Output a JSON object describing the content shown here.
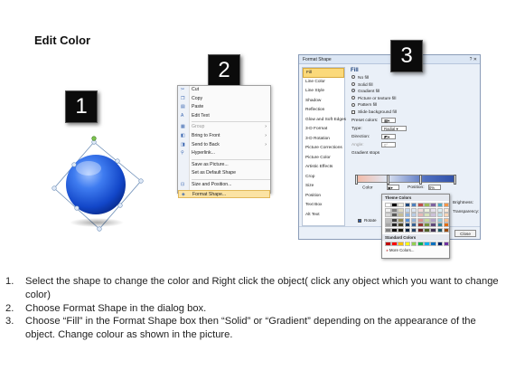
{
  "title": "Edit Color",
  "steps": [
    "1",
    "2",
    "3"
  ],
  "context_menu": {
    "items": [
      {
        "label": "Cut",
        "icon": "scissors-icon",
        "glyph": "✂",
        "disabled": false,
        "submenu": false
      },
      {
        "label": "Copy",
        "icon": "copy-icon",
        "glyph": "❐",
        "disabled": false,
        "submenu": false
      },
      {
        "label": "Paste",
        "icon": "paste-icon",
        "glyph": "▤",
        "disabled": false,
        "submenu": false
      },
      {
        "label": "Edit Text",
        "icon": "edit-text-icon",
        "glyph": "A",
        "disabled": false,
        "submenu": false
      },
      {
        "label": "Group",
        "icon": "group-icon",
        "glyph": "▦",
        "disabled": true,
        "submenu": true
      },
      {
        "label": "Bring to Front",
        "icon": "bring-front-icon",
        "glyph": "◧",
        "disabled": false,
        "submenu": true
      },
      {
        "label": "Send to Back",
        "icon": "send-back-icon",
        "glyph": "◨",
        "disabled": false,
        "submenu": true
      },
      {
        "label": "Hyperlink...",
        "icon": "hyperlink-icon",
        "glyph": "⚲",
        "disabled": false,
        "submenu": false
      },
      {
        "label": "Save as Picture...",
        "icon": "",
        "glyph": "",
        "disabled": false,
        "submenu": false
      },
      {
        "label": "Set as Default Shape",
        "icon": "",
        "glyph": "",
        "disabled": false,
        "submenu": false
      },
      {
        "label": "Size and Position...",
        "icon": "size-position-icon",
        "glyph": "⊡",
        "disabled": false,
        "submenu": false
      },
      {
        "label": "Format Shape...",
        "icon": "format-shape-icon",
        "glyph": "◈",
        "disabled": false,
        "submenu": false,
        "highlighted": true
      }
    ]
  },
  "dialog": {
    "title": "Format Shape",
    "window_controls": "? ✕",
    "nav": [
      "Fill",
      "Line Color",
      "Line Style",
      "Shadow",
      "Reflection",
      "Glow and Soft Edges",
      "3-D Format",
      "3-D Rotation",
      "Picture Corrections",
      "Picture Color",
      "Artistic Effects",
      "Crop",
      "Size",
      "Position",
      "Text Box",
      "Alt Text"
    ],
    "selected_nav": "Fill",
    "fill_heading": "Fill",
    "fill_options": [
      {
        "label": "No fill",
        "selected": false
      },
      {
        "label": "Solid fill",
        "selected": false
      },
      {
        "label": "Gradient fill",
        "selected": true
      },
      {
        "label": "Picture or texture fill",
        "selected": false
      },
      {
        "label": "Pattern fill",
        "selected": false
      }
    ],
    "slide_background_fill": "Slide background fill",
    "preset_colors_label": "Preset colors:",
    "type_label": "Type:",
    "type_value": "Radial",
    "direction_label": "Direction:",
    "angle_label": "Angle:",
    "angle_value": "0°",
    "gradient_stops_label": "Gradient stops",
    "color_label": "Color",
    "position_label": "Position:",
    "position_value": "0%",
    "brightness_label": "Brightness:",
    "transparency_label": "Transparency:",
    "rotate_label": "Rotate",
    "close_label": "Close"
  },
  "palette": {
    "theme_label": "Theme Colors",
    "standard_label": "Standard Colors",
    "more_label": "More Colors...",
    "theme_rows": [
      [
        "#ffffff",
        "#000000",
        "#eeece1",
        "#1f497d",
        "#4f81bd",
        "#c0504d",
        "#9bbb59",
        "#8064a2",
        "#4bacc6",
        "#f79646"
      ],
      [
        "#f2f2f2",
        "#7f7f7f",
        "#ddd9c3",
        "#c6d9f0",
        "#dbe5f1",
        "#f2dcdb",
        "#ebf1dd",
        "#e5e0ec",
        "#dbeef3",
        "#fdeada"
      ],
      [
        "#d8d8d8",
        "#595959",
        "#c4bd97",
        "#8db3e2",
        "#b8cce4",
        "#e5b9b7",
        "#d7e3bc",
        "#ccc1d9",
        "#b7dde8",
        "#fbd5b5"
      ],
      [
        "#bfbfbf",
        "#3f3f3f",
        "#938953",
        "#548dd4",
        "#95b3d7",
        "#d99694",
        "#c3d69b",
        "#b2a2c7",
        "#92cddc",
        "#fac08f"
      ],
      [
        "#a5a5a5",
        "#262626",
        "#494429",
        "#17365d",
        "#366092",
        "#953734",
        "#76923c",
        "#5f497a",
        "#31859b",
        "#e36c09"
      ],
      [
        "#7f7f7f",
        "#0c0c0c",
        "#1d1b10",
        "#0f243e",
        "#244061",
        "#632423",
        "#4f6128",
        "#3f3151",
        "#205867",
        "#974806"
      ]
    ],
    "standard": [
      "#c00000",
      "#ff0000",
      "#ffc000",
      "#ffff00",
      "#92d050",
      "#00b050",
      "#00b0f0",
      "#0070c0",
      "#002060",
      "#7030a0"
    ]
  },
  "instructions": [
    {
      "num": "1.",
      "text": "Select the shape to change the color and Right click the object( click any object which you want to change color)"
    },
    {
      "num": "2.",
      "text": "Choose Format Shape in the dialog box."
    },
    {
      "num": "3.",
      "text": "Choose “Fill” in the Format Shape box then “Solid” or “Gradient” depending on the appearance of the object. Change colour as shown in the picture."
    }
  ],
  "colors": {
    "accent_blue": "#2d5aa8",
    "menu_highlight": "#fbe3a4",
    "sphere": "#1f5fe0"
  }
}
